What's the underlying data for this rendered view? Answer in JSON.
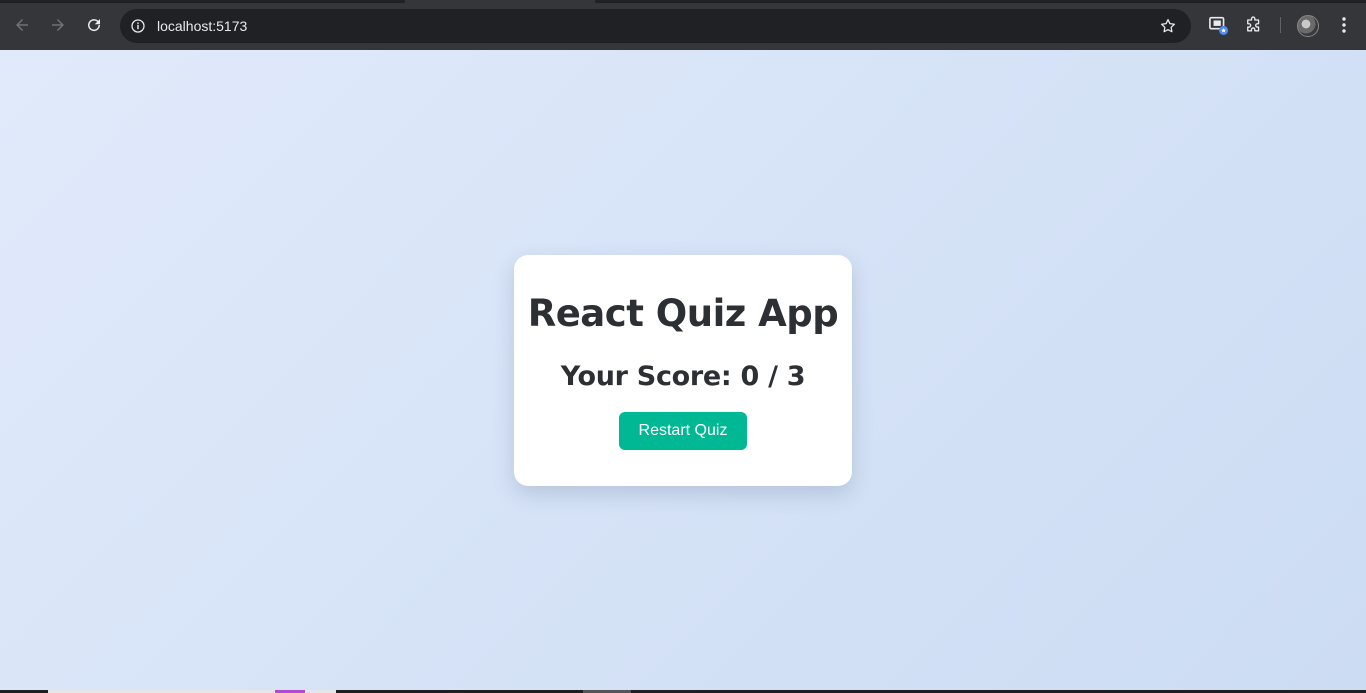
{
  "browser": {
    "url": "localhost:5173",
    "icons": {
      "back": "back-arrow-icon",
      "forward": "forward-arrow-icon",
      "reload": "reload-icon",
      "site_info": "info-icon",
      "bookmark": "star-icon",
      "cast": "cast-icon",
      "extensions": "puzzle-icon",
      "profile": "avatar",
      "menu": "kebab-menu-icon"
    }
  },
  "quiz": {
    "title": "React Quiz App",
    "score_text": "Your Score: 0 / 3",
    "score": 0,
    "total": 3,
    "restart_label": "Restart Quiz",
    "accent_color": "#00b894"
  }
}
